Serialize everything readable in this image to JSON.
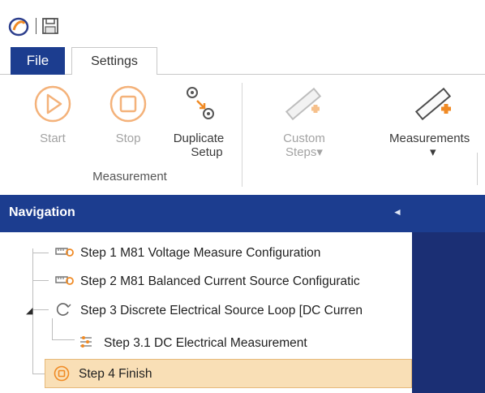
{
  "quick_access": {
    "app_icon": "app-logo-icon",
    "save_icon": "save-icon"
  },
  "tabs": [
    {
      "label": "File"
    },
    {
      "label": "Settings"
    }
  ],
  "ribbon": {
    "buttons": {
      "start": {
        "label": "Start",
        "icon": "play-circle-icon",
        "enabled": false
      },
      "stop": {
        "label": "Stop",
        "icon": "stop-circle-icon",
        "enabled": false
      },
      "duplicate": {
        "line1": "Duplicate",
        "line2": "Setup",
        "icon": "duplicate-gears-icon",
        "enabled": true
      },
      "custom_steps": {
        "line1": "Custom",
        "line2": "Steps",
        "arrow": "▾",
        "icon": "ruler-plus-icon",
        "enabled": false
      },
      "measurements": {
        "line1": "Measurements",
        "arrow": "▾",
        "icon": "ruler-plus-icon",
        "enabled": true
      }
    },
    "group_label": "Measurement"
  },
  "navigation": {
    "title": "Navigation",
    "collapse_icon": "◄",
    "steps": [
      {
        "label": "Step 1 M81 Voltage Measure Configuration",
        "icon": "config-icon"
      },
      {
        "label": "Step 2 M81 Balanced Current Source Configuratic",
        "icon": "config-icon"
      },
      {
        "label": "Step 3 Discrete Electrical Source Loop [DC Curren",
        "icon": "loop-icon",
        "expanded": true
      },
      {
        "label": "Step 3.1 DC Electrical Measurement",
        "icon": "measurement-icon"
      },
      {
        "label": "Step 4 Finish",
        "icon": "finish-icon",
        "selected": true
      }
    ]
  },
  "colors": {
    "accent": "#1c3d8f",
    "selection": "#f9dfb6",
    "ribbon_icon_orange": "#f29a38",
    "panel_dark": "#1b2f74"
  }
}
